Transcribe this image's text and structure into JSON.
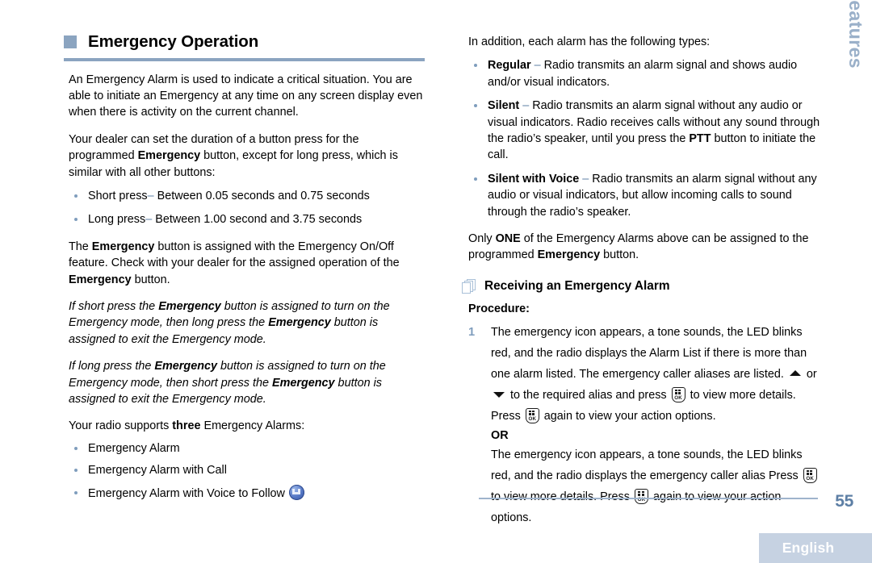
{
  "chapter": {
    "title": "Emergency Operation",
    "accent_color": "#8ba4c0"
  },
  "left_column": {
    "intro_paragraph": "An Emergency Alarm is used to indicate a critical situation. You are able to initiate an Emergency at any time on any screen display even when there is activity on the current channel.",
    "dealer_paragraph": {
      "part1": "Your dealer can set the duration of a button press for the programmed ",
      "bold1": "Emergency",
      "part2": " button, except for long press, which is similar with all other buttons:"
    },
    "press_durations": [
      {
        "label": "Short press",
        "dash": "–",
        "text": " Between 0.05 seconds and 0.75 seconds"
      },
      {
        "label": "Long press",
        "dash": "–",
        "text": " Between 1.00 second and 3.75 seconds"
      }
    ],
    "assigned_paragraph": {
      "part1": "The ",
      "bold1": "Emergency",
      "part2": " button is assigned with the Emergency On/Off feature. Check with your dealer for the assigned operation of the ",
      "bold2": "Emergency",
      "part3": " button."
    },
    "note_short_press": {
      "part1": "If short press the ",
      "bold1": "Emergency",
      "part2": " button is assigned to turn on the Emergency mode, then long press the ",
      "bold2": "Emergency",
      "part3": " button is assigned to exit the Emergency mode."
    },
    "note_long_press": {
      "part1": "If long press the ",
      "bold1": "Emergency",
      "part2": " button is assigned to turn on the Emergency mode, then short press the ",
      "bold2": "Emergency",
      "part3": " button is assigned to exit the Emergency mode."
    },
    "supports_paragraph": {
      "part1": "Your radio supports ",
      "bold1": "three",
      "part2": " Emergency Alarms:"
    },
    "alarm_types": [
      {
        "text": "Emergency Alarm",
        "icon": ""
      },
      {
        "text": "Emergency Alarm with Call",
        "icon": ""
      },
      {
        "text": "Emergency Alarm with Voice to Follow",
        "icon": "voice-to-follow-icon"
      }
    ]
  },
  "right_column": {
    "intro_paragraph": "In addition, each alarm has the following types:",
    "alarm_modes": [
      {
        "label": "Regular",
        "dash": "–",
        "text": " Radio transmits an alarm signal and shows audio and/or visual indicators."
      },
      {
        "label": "Silent",
        "dash": "–",
        "text_part1": " Radio transmits an alarm signal without any audio or visual indicators. Radio receives calls without any sound through the radio’s speaker, until you press the ",
        "bold_inline": "PTT",
        "text_part2": " button to initiate the call."
      },
      {
        "label": "Silent with Voice",
        "dash": "–",
        "text": " Radio transmits an alarm signal without any audio or visual indicators, but allow incoming calls to sound through the radio’s speaker."
      }
    ],
    "only_one_paragraph": {
      "part1": "Only ",
      "bold1": "ONE",
      "part2": " of the Emergency Alarms above can be assigned to the programmed ",
      "bold2": "Emergency",
      "part3": " button."
    },
    "subsection": {
      "icon": "stacked-pages-icon",
      "title": "Receiving an Emergency Alarm",
      "procedure_label": "Procedure:"
    },
    "procedure_steps": [
      {
        "number": "1",
        "text_a": "The emergency icon appears, a tone sounds, the LED blinks red, and the radio displays the Alarm List if there is more than one alarm listed. The emergency caller aliases are listed. ",
        "arrow_up": "up-arrow-icon",
        "or_text": " or ",
        "arrow_down": "down-arrow-icon",
        "text_b": " to the required alias and press ",
        "ok_icon_1": "ok-button-icon",
        "text_c": " to view more details. Press ",
        "ok_icon_2": "ok-button-icon",
        "text_d": " again to view your action options.",
        "or_separator": "OR",
        "alt_text_a": "The emergency icon appears, a tone sounds, the LED blinks red, and the radio displays the emergency caller alias Press ",
        "alt_ok_1": "ok-button-icon",
        "alt_text_b": " to view more details. Press ",
        "alt_ok_2": "ok-button-icon",
        "alt_text_c": " again to view your action options."
      }
    ]
  },
  "side_tab": {
    "label": "Advanced Features",
    "color": "#9ab0c9"
  },
  "footer": {
    "page_number": "55",
    "language": "English",
    "bar_color": "#c6d2e2"
  },
  "icons": {
    "ok_label": "OK"
  }
}
